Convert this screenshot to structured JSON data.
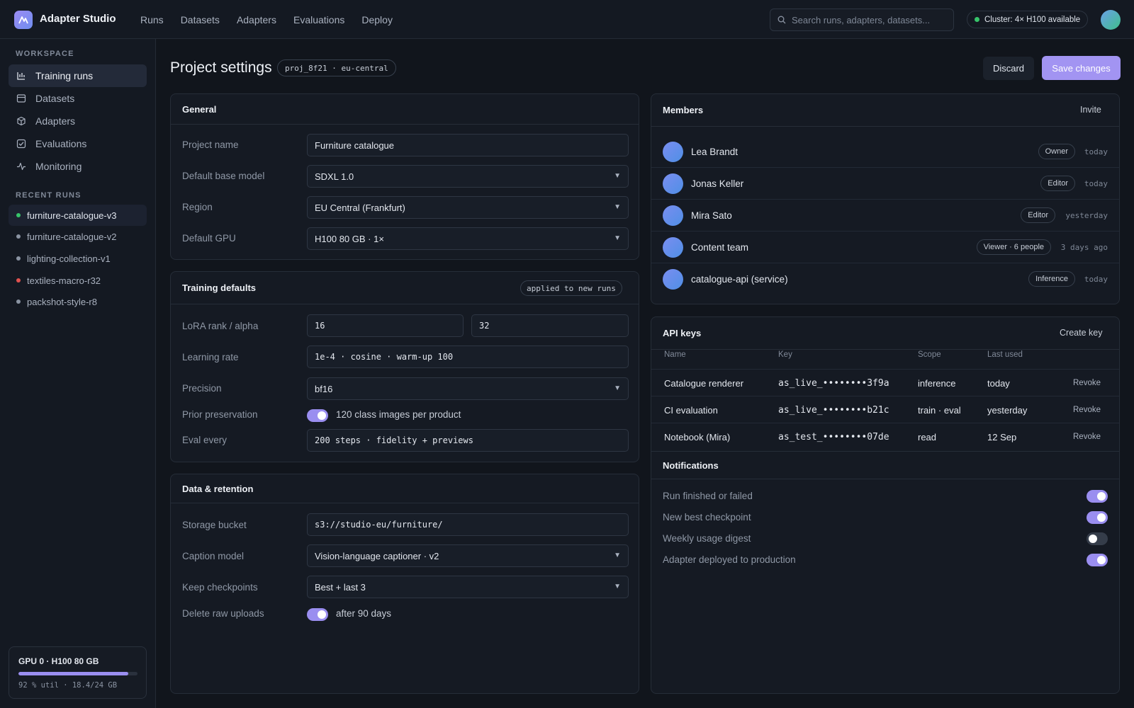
{
  "app": {
    "title": "Adapter Studio"
  },
  "topnav": [
    "Runs",
    "Datasets",
    "Adapters",
    "Evaluations",
    "Deploy"
  ],
  "search": {
    "placeholder": "Search runs, adapters, datasets..."
  },
  "cluster": {
    "label": "Cluster: 4× H100 available",
    "status_color": "#37c46a"
  },
  "sidebar": {
    "workspace_heading": "WORKSPACE",
    "items": [
      {
        "label": "Training runs",
        "icon": "bar-chart-icon"
      },
      {
        "label": "Datasets",
        "icon": "table-icon"
      },
      {
        "label": "Adapters",
        "icon": "cube-icon"
      },
      {
        "label": "Evaluations",
        "icon": "check-square-icon"
      },
      {
        "label": "Monitoring",
        "icon": "activity-icon"
      }
    ],
    "recent_heading": "RECENT RUNS",
    "recent_runs": [
      {
        "label": "furniture-catalogue-v3",
        "color": "#37c46a"
      },
      {
        "label": "furniture-catalogue-v2",
        "color": "#8a93a2"
      },
      {
        "label": "lighting-collection-v1",
        "color": "#8a93a2"
      },
      {
        "label": "textiles-macro-r32",
        "color": "#e0514f"
      },
      {
        "label": "packshot-style-r8",
        "color": "#8a93a2"
      }
    ],
    "gpu": {
      "title": "GPU 0 · H100 80 GB",
      "util_text": "92 % util · 18.4/24 GB",
      "util_fraction": 0.92
    }
  },
  "page": {
    "title": "Project settings",
    "project_chip": "proj_8f21 · eu-central",
    "discard_label": "Discard",
    "save_label": "Save changes"
  },
  "general": {
    "title": "General",
    "project_name_label": "Project name",
    "project_name_value": "Furniture catalogue",
    "base_model_label": "Default base model",
    "base_model_value": "SDXL 1.0",
    "region_label": "Region",
    "region_value": "EU Central (Frankfurt)",
    "gpu_label": "Default GPU",
    "gpu_value": "H100 80 GB · 1×"
  },
  "training": {
    "title": "Training defaults",
    "badge": "applied to new runs",
    "lora_label": "LoRA rank / alpha",
    "lora_rank": "16",
    "lora_alpha": "32",
    "lr_label": "Learning rate",
    "lr_value": "1e-4 · cosine · warm-up 100",
    "precision_label": "Precision",
    "precision_value": "bf16",
    "prior_label": "Prior preservation",
    "prior_text": "120 class images per product",
    "prior_on": true,
    "eval_label": "Eval every",
    "eval_value": "200 steps · fidelity + previews"
  },
  "data": {
    "title": "Data & retention",
    "bucket_label": "Storage bucket",
    "bucket_value": "s3://studio-eu/furniture/",
    "caption_label": "Caption model",
    "caption_value": "Vision-language captioner · v2",
    "checkpoints_label": "Keep checkpoints",
    "checkpoints_value": "Best + last 3",
    "delete_label": "Delete raw uploads",
    "delete_text": "after 90 days",
    "delete_on": true
  },
  "members": {
    "title": "Members",
    "invite_label": "Invite",
    "list": [
      {
        "name": "Lea Brandt",
        "role": "Owner",
        "time": "today"
      },
      {
        "name": "Jonas Keller",
        "role": "Editor",
        "time": "today"
      },
      {
        "name": "Mira Sato",
        "role": "Editor",
        "time": "yesterday"
      },
      {
        "name": "Content team",
        "role": "Viewer · 6 people",
        "time": "3 days ago"
      },
      {
        "name": "catalogue-api (service)",
        "role": "Inference",
        "time": "today"
      }
    ]
  },
  "api_keys": {
    "title": "API keys",
    "create_label": "Create key",
    "columns": [
      "Name",
      "Key",
      "Scope",
      "Last used"
    ],
    "rows": [
      {
        "name": "Catalogue renderer",
        "key": "as_live_••••••••3f9a",
        "scope": "inference",
        "last_used": "today",
        "action": "Revoke"
      },
      {
        "name": "CI evaluation",
        "key": "as_live_••••••••b21c",
        "scope": "train · eval",
        "last_used": "yesterday",
        "action": "Revoke"
      },
      {
        "name": "Notebook (Mira)",
        "key": "as_test_••••••••07de",
        "scope": "read",
        "last_used": "12 Sep",
        "action": "Revoke"
      }
    ]
  },
  "notifications": {
    "title": "Notifications",
    "items": [
      {
        "label": "Run finished or failed",
        "on": true
      },
      {
        "label": "New best checkpoint",
        "on": true
      },
      {
        "label": "Weekly usage digest",
        "on": false
      },
      {
        "label": "Adapter deployed to production",
        "on": true
      }
    ]
  }
}
